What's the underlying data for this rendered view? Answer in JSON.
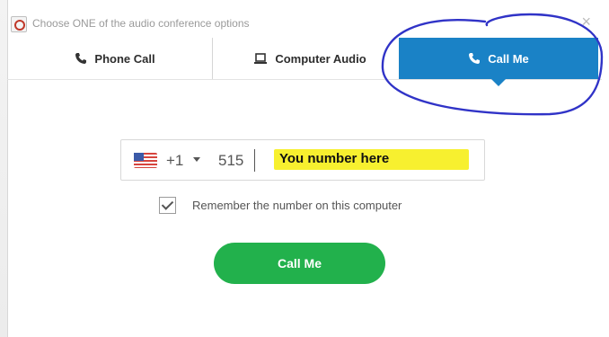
{
  "window": {
    "title": "Choose ONE of the audio conference options",
    "close_glyph": "×"
  },
  "tabs": [
    {
      "label": "Phone Call",
      "icon": "phone-icon",
      "selected": false
    },
    {
      "label": "Computer Audio",
      "icon": "laptop-icon",
      "selected": false
    },
    {
      "label": "Call Me",
      "icon": "phone-icon",
      "selected": true
    }
  ],
  "phone_input": {
    "country_flag": "us-flag-icon",
    "country_code": "+1",
    "value": "515",
    "annotation_text": "You number here"
  },
  "remember": {
    "checked": true,
    "label": "Remember the number on this computer"
  },
  "action": {
    "label": "Call Me",
    "color": "#22b14c"
  },
  "colors": {
    "selected_tab": "#1a82c6",
    "annotation_circle": "#3033c7",
    "annotation_highlight": "#f7f02f"
  }
}
